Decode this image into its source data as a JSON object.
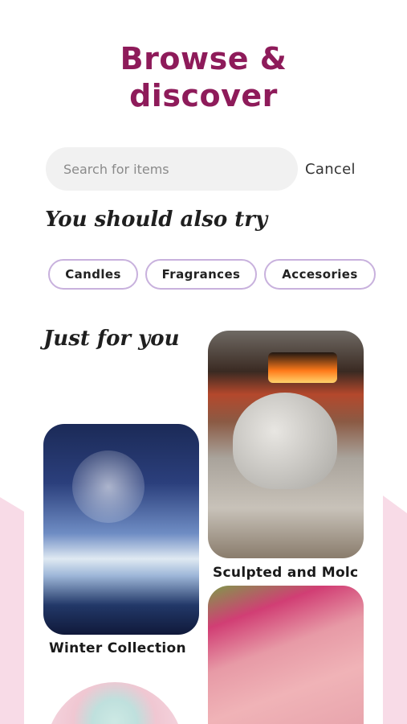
{
  "header": {
    "title_line1": "Browse &",
    "title_line2": "discover"
  },
  "search": {
    "placeholder": "Search for items",
    "value": "",
    "cancel_label": "Cancel"
  },
  "suggestions": {
    "heading": "You should also try",
    "chips": [
      "Candles",
      "Fragrances",
      "Accesories"
    ]
  },
  "recommendations": {
    "heading": "Just for you",
    "items": [
      {
        "label": "Winter Collection"
      },
      {
        "label": "Sculpted and Molc"
      },
      {
        "label": ""
      },
      {
        "label": ""
      }
    ]
  },
  "colors": {
    "title": "#8e1b5a",
    "chip_border": "#c8b1dd",
    "side_accent": "#f8dbe7"
  }
}
